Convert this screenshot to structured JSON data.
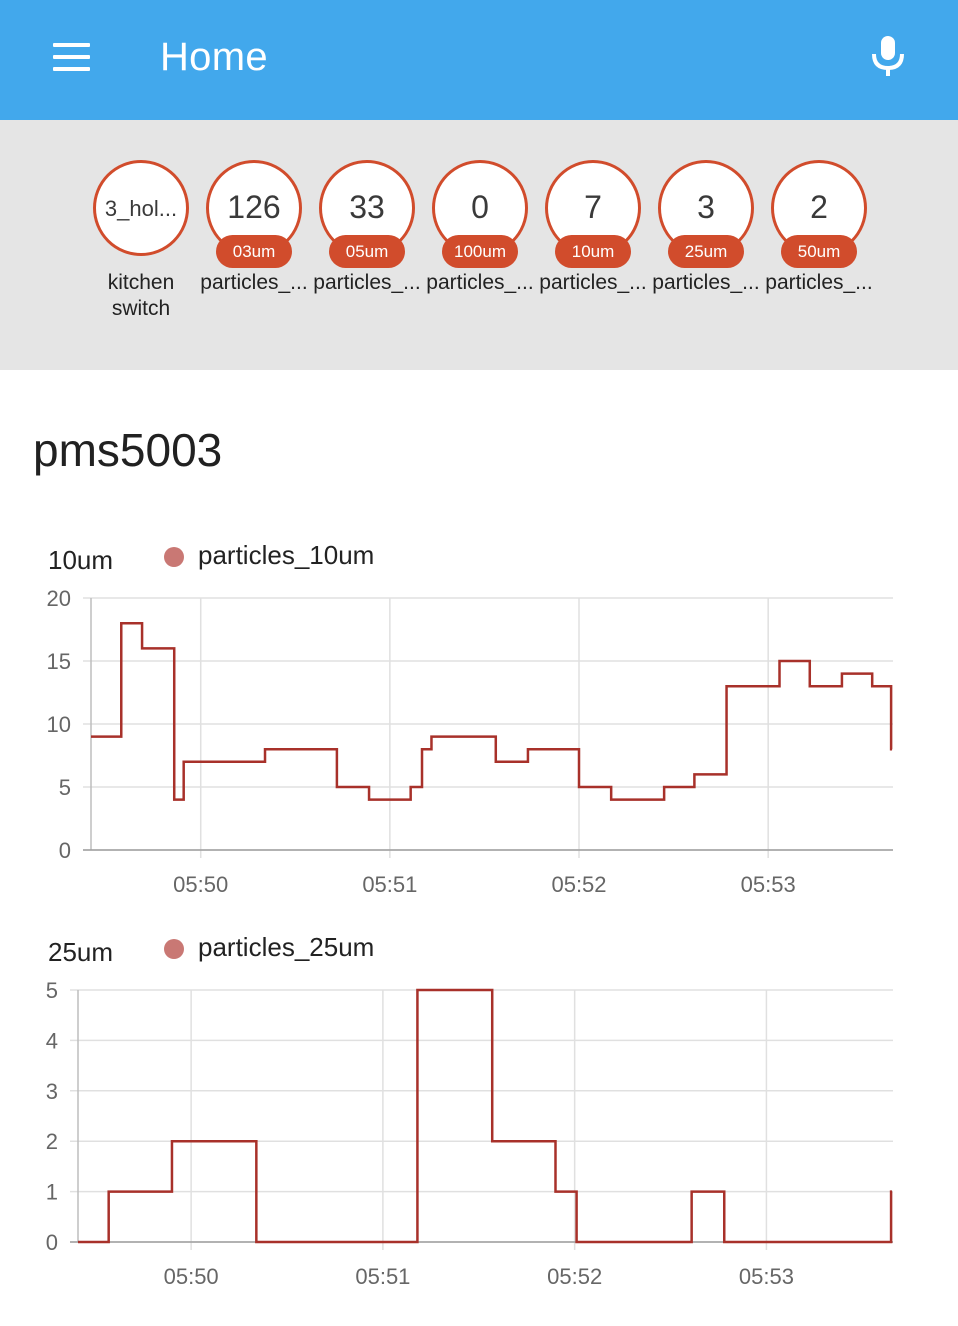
{
  "appbar": {
    "title": "Home",
    "menu_icon": "hamburger-menu-icon",
    "mic_icon": "microphone-icon",
    "color": "#42a8ec"
  },
  "badges": [
    {
      "value": "3_hol...",
      "unit": "",
      "label": "kitchen\nswitch"
    },
    {
      "value": "126",
      "unit": "03um",
      "label": "particles_..."
    },
    {
      "value": "33",
      "unit": "05um",
      "label": "particles_..."
    },
    {
      "value": "0",
      "unit": "100um",
      "label": "particles_..."
    },
    {
      "value": "7",
      "unit": "10um",
      "label": "particles_..."
    },
    {
      "value": "3",
      "unit": "25um",
      "label": "particles_..."
    },
    {
      "value": "2",
      "unit": "50um",
      "label": "particles_..."
    }
  ],
  "badge_color": "#d14c2c",
  "card": {
    "title": "pms5003"
  },
  "chart_data": [
    {
      "type": "line",
      "step": true,
      "unit_label": "10um",
      "series": [
        {
          "name": "particles_10um",
          "color": "#a8312a",
          "dot_color": "#c97874"
        }
      ],
      "ylim": [
        0,
        20
      ],
      "yticks": [
        "0",
        "5",
        "10",
        "15",
        "20"
      ],
      "xticks": [
        "05:50",
        "05:51",
        "05:52",
        "05:53"
      ],
      "xlim_minutes": [
        49.42,
        53.66
      ],
      "grid": true,
      "points": [
        [
          49.42,
          9
        ],
        [
          49.58,
          18
        ],
        [
          49.69,
          16
        ],
        [
          49.86,
          4
        ],
        [
          49.91,
          7
        ],
        [
          50.34,
          8
        ],
        [
          50.72,
          5
        ],
        [
          50.89,
          4
        ],
        [
          51.11,
          5
        ],
        [
          51.17,
          8
        ],
        [
          51.22,
          9
        ],
        [
          51.56,
          7
        ],
        [
          51.73,
          8
        ],
        [
          52.0,
          5
        ],
        [
          52.17,
          4
        ],
        [
          52.45,
          5
        ],
        [
          52.61,
          6
        ],
        [
          52.78,
          13
        ],
        [
          53.06,
          15
        ],
        [
          53.22,
          13
        ],
        [
          53.39,
          14
        ],
        [
          53.55,
          13
        ],
        [
          53.65,
          8
        ]
      ]
    },
    {
      "type": "line",
      "step": true,
      "unit_label": "25um",
      "series": [
        {
          "name": "particles_25um",
          "color": "#a8312a",
          "dot_color": "#c97874"
        }
      ],
      "ylim": [
        0,
        5
      ],
      "yticks": [
        "0",
        "1",
        "2",
        "3",
        "4",
        "5"
      ],
      "xticks": [
        "05:50",
        "05:51",
        "05:52",
        "05:53"
      ],
      "xlim_minutes": [
        49.41,
        53.66
      ],
      "grid": true,
      "points": [
        [
          49.41,
          0
        ],
        [
          49.57,
          1
        ],
        [
          49.9,
          2
        ],
        [
          50.34,
          0
        ],
        [
          51.18,
          5
        ],
        [
          51.57,
          2
        ],
        [
          51.9,
          1
        ],
        [
          52.01,
          0
        ],
        [
          52.61,
          1
        ],
        [
          52.78,
          0
        ],
        [
          53.65,
          1
        ]
      ]
    }
  ]
}
